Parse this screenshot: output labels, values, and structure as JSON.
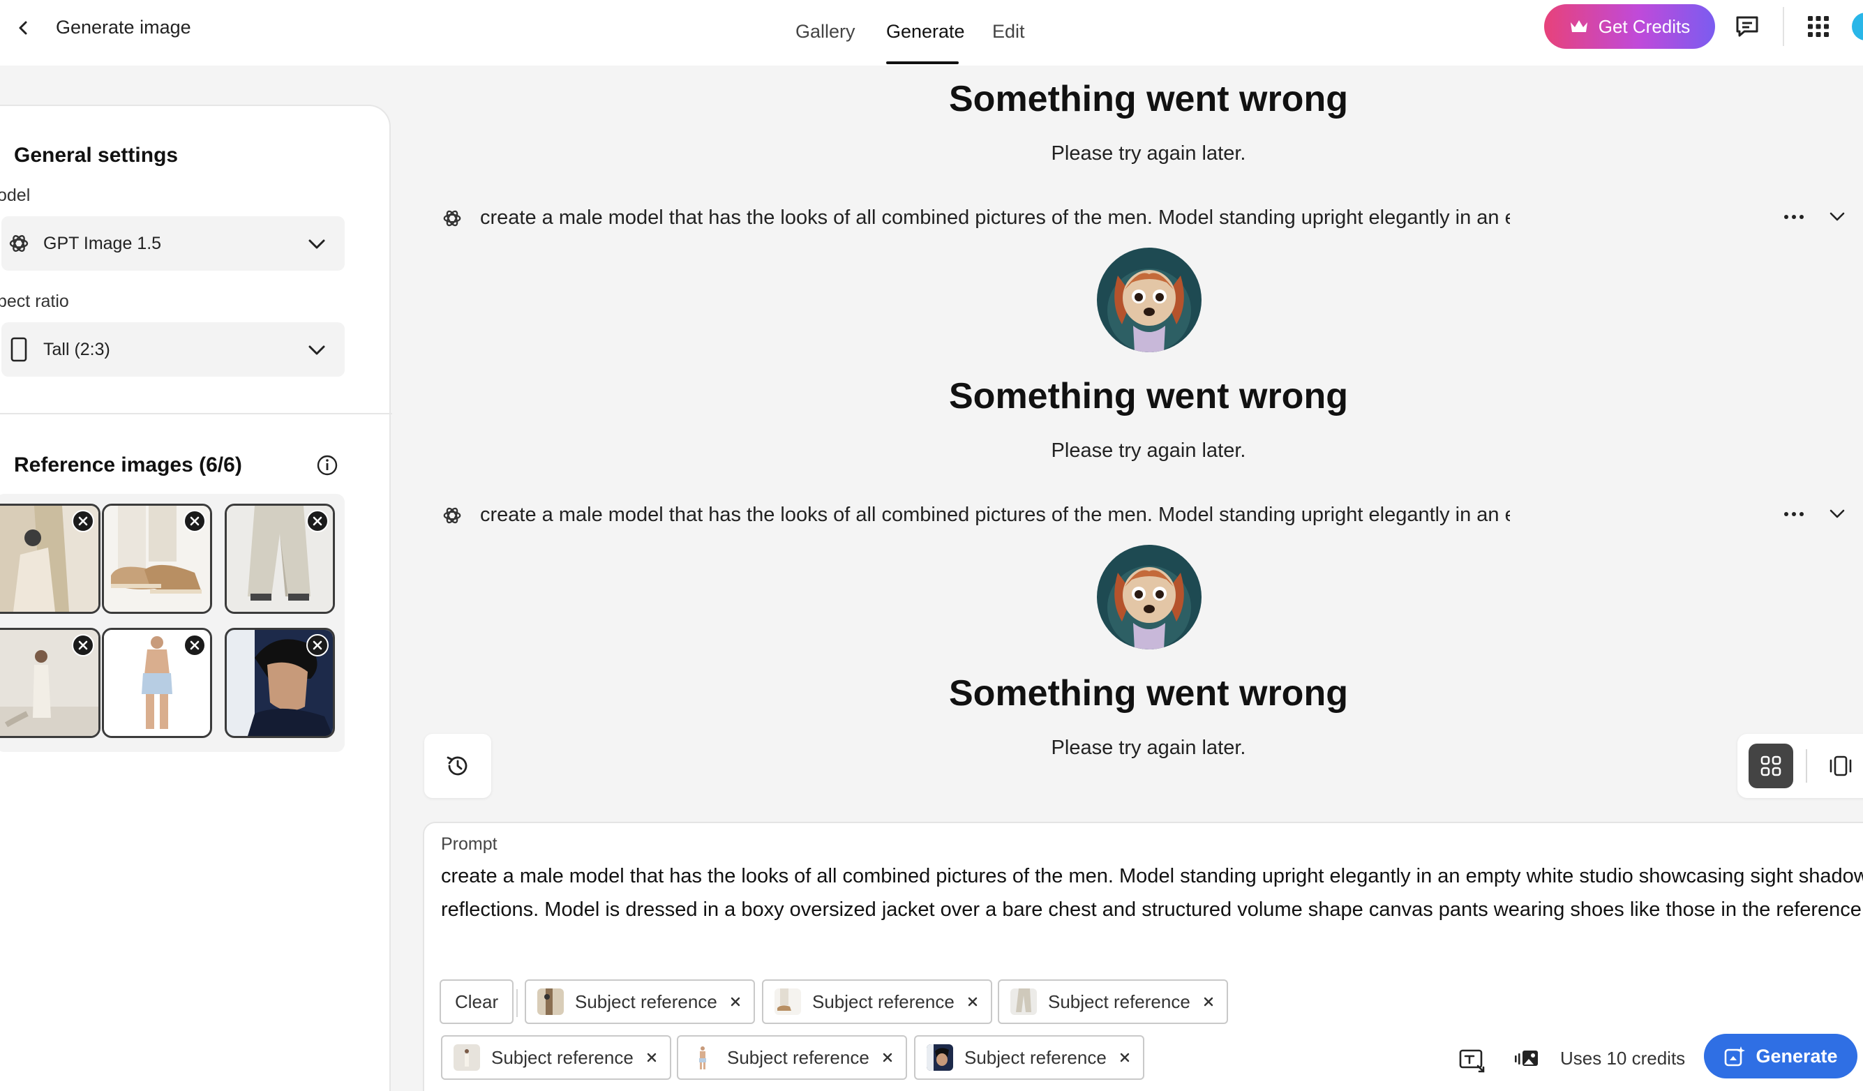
{
  "header": {
    "title": "Generate image",
    "tabs": [
      {
        "label": "Gallery",
        "active": false
      },
      {
        "label": "Generate",
        "active": true
      },
      {
        "label": "Edit",
        "active": false
      }
    ],
    "get_credits_label": "Get Credits",
    "get_credits_colors": [
      "#e7427a",
      "#c04ad9",
      "#7b5cf0"
    ]
  },
  "settings": {
    "heading": "General settings",
    "model_label": "odel",
    "model_value": "GPT Image 1.5",
    "aspect_label": "pect ratio",
    "aspect_value": "Tall (2:3)"
  },
  "references": {
    "heading": "Reference images (6/6)",
    "images": [
      {
        "name": "cream-jacket-detail"
      },
      {
        "name": "loafers-and-trousers"
      },
      {
        "name": "cream-wide-pants"
      },
      {
        "name": "white-studio-figure"
      },
      {
        "name": "shirtless-model-shorts"
      },
      {
        "name": "dark-haired-portrait"
      }
    ]
  },
  "feed": {
    "errors": [
      {
        "title": "Something went wrong",
        "subtitle": "Please try again later."
      },
      {
        "title": "Something went wrong",
        "subtitle": "Please try again later."
      },
      {
        "title": "Something went wrong",
        "subtitle": "Please try again later."
      }
    ],
    "prompts": [
      {
        "text": "create a male model that has the looks of all combined pictures of the men. Model standing upright elegantly in an empty white studio showca"
      },
      {
        "text": "create a male model that has the looks of all combined pictures of the men. Model standing upright elegantly in an empty white studio showca"
      }
    ]
  },
  "composer": {
    "label": "Prompt",
    "text": "create a male model that has the looks of all combined pictures of the men. Model standing upright elegantly in an empty white studio showcasing sight shadow reflections. Model is dressed in a boxy oversized jacket over a bare chest and structured volume shape canvas pants wearing shoes like those in the reference",
    "clear_label": "Clear",
    "chips": [
      {
        "label": "Subject reference"
      },
      {
        "label": "Subject reference"
      },
      {
        "label": "Subject reference"
      },
      {
        "label": "Subject reference"
      },
      {
        "label": "Subject reference"
      },
      {
        "label": "Subject reference"
      }
    ],
    "credits_text": "Uses 10 credits",
    "generate_label": "Generate",
    "generate_color": "#2f6fe4"
  }
}
